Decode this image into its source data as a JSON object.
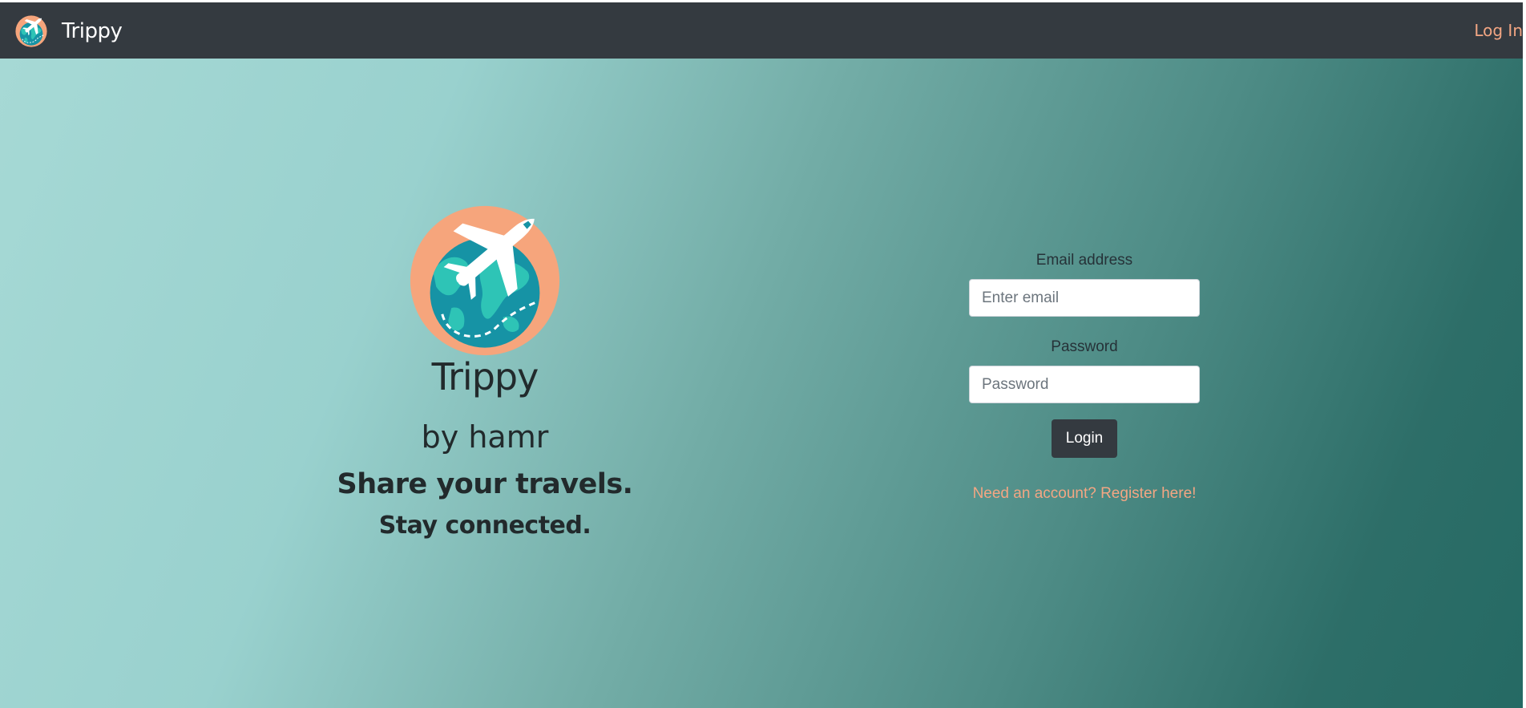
{
  "navbar": {
    "brand": "Trippy",
    "login_link": "Log In",
    "logo_icon": "globe-airplane-logo-icon"
  },
  "hero": {
    "logo_icon": "globe-airplane-logo-icon",
    "title": "Trippy",
    "byline": "by hamr",
    "tagline_1": "Share your travels.",
    "tagline_2": "Stay connected."
  },
  "login_form": {
    "email_label": "Email address",
    "email_placeholder": "Enter email",
    "email_value": "",
    "password_label": "Password",
    "password_placeholder": "Password",
    "password_value": "",
    "submit_label": "Login",
    "register_link": "Need an account? Register here!"
  },
  "colors": {
    "navbar_bg": "#343a40",
    "accent": "#f3a683",
    "gradient_start": "#a6d9d5",
    "gradient_end": "#256a64",
    "button_bg": "#343a40"
  }
}
